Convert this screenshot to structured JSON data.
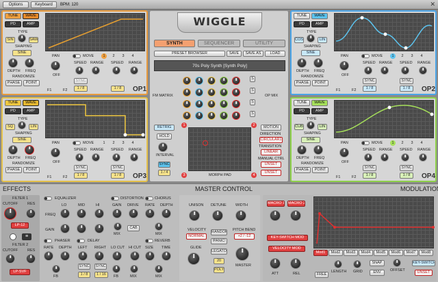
{
  "topbar": {
    "options": "Options",
    "keyboard": "Keyboard",
    "bpm": "BPM: 120",
    "close": "✕"
  },
  "logo": "WIGGLE",
  "tabs": [
    "SYNTH",
    "SEQUENCER",
    "UTILITY"
  ],
  "preset": {
    "browser": "PRESET BROWSER",
    "save": "SAVE",
    "save_as": "SAVE AS",
    "load": "LOAD",
    "name": "70s Poly Synth [Synth Poly]"
  },
  "center": {
    "fm_matrix": "FM MATRIX",
    "op_mix": "OP MIX",
    "s": "S",
    "retrig": "RETRIG",
    "hold": "HOLD",
    "interval": "INTERVAL",
    "sync": "SYNC",
    "quarter": "1 / 4",
    "motion": "MOTION",
    "direction": "DIRECTION",
    "circular": "CIRCULAR1",
    "transition": "TRANSITION",
    "linear": "LINEAR",
    "manual_ctrl": "MANUAL CTRL",
    "unset": "UNSET",
    "morph_pad": "MORPH PAD",
    "n1": "1",
    "n2": "2",
    "n3": "3",
    "n4": "4"
  },
  "op": {
    "tune": "TUNE",
    "wave": "WAVE",
    "pd": "PD",
    "amp": "AMP",
    "type": "TYPE",
    "shaping": "SHAPING",
    "sine": "SINE",
    "depth": "DEPTH",
    "freq": "FREQ",
    "randomize": "RANDOMIZE",
    "phase": "PHASE",
    "point": "POINT",
    "pan": "PAN",
    "move": "MOVE",
    "off": "OFF",
    "speed": "SPEED",
    "range": "RANGE",
    "sync": "SYNC",
    "eighth": "1 / 8",
    "f1": "F1",
    "f2": "F2",
    "n1": "1",
    "n2": "2",
    "n3": "3",
    "n4": "4"
  },
  "op1": {
    "label": "OP1",
    "type_a": "SIN",
    "type_b": "SAW"
  },
  "op2": {
    "label": "OP2",
    "type_a": "COS",
    "type_b": "LIN"
  },
  "op3": {
    "label": "OP3",
    "type_a": "SQ",
    "type_b": "LIN"
  },
  "op4": {
    "label": "OP4",
    "type_a": "CUB",
    "type_b": "LIN"
  },
  "effects": {
    "title": "EFFECTS",
    "filter1": "FILTER 1",
    "cutoff": "CUTOFF",
    "res": "RES",
    "lp12": "LP-12",
    "filter2": "FILTER 2",
    "lpsvf": "LP-SVF",
    "equalizer": "EQUALIZER",
    "freq": "FREQ",
    "lo": "LO",
    "mid": "MID",
    "hi": "HI",
    "gain": "GAIN",
    "distortion": "DISTORTION",
    "drive": "DRIVE",
    "mix": "MIX",
    "cab": "CAB",
    "chorus": "CHORUS",
    "rate": "RATE",
    "depth": "DEPTH",
    "phaser": "PHASER",
    "fb": "FB",
    "delay": "DELAY",
    "left": "LEFT",
    "right": "RIGHT",
    "locut": "LO CUT",
    "hicut": "HI CUT",
    "sync": "SYNC",
    "eighth": "1 / 8",
    "sixteenth": "1 / 16",
    "reverb": "REVERB",
    "size": "SIZE",
    "time": "TIME"
  },
  "master": {
    "title": "MASTER CONTROL",
    "unison": "UNISON",
    "detune": "DETUNE",
    "width": "WIDTH",
    "velocity": "VELOCITY",
    "normal": "NORMAL",
    "random": "RANDOM",
    "panic": "!PANIC!",
    "pitch_bend": "PITCH BEND",
    "pb_val": "+2 / -12",
    "glide": "GLIDE",
    "legato": "LEGATO",
    "voices": "20",
    "poly": "POLY",
    "master": "MASTER"
  },
  "mod": {
    "title": "MODULATIONS",
    "macro1": "MACRO 1",
    "macro2": "MACRO 2",
    "keyswitch_mod": "KEY-SWITCH MOD",
    "velocity_mod": "VELOCITY MOD",
    "att": "ATT",
    "rel": "REL",
    "tabs": [
      "Mod1",
      "Mod2",
      "Mod3",
      "Mod4",
      "Mod5",
      "Mod6",
      "Mod7",
      "Mod8"
    ],
    "length": "LENGTH",
    "grid": "GRID",
    "snap": "SNAP",
    "offset": "OFFSET",
    "keyswitch": "KEY-SWITCH",
    "free": "FREE",
    "env": "ENV",
    "unset": "UNSET"
  },
  "colors": {
    "op1": "#e89a3c",
    "op2": "#4aa4e8",
    "op3": "#e6c24a",
    "op4": "#8fd24a",
    "red": "#e03030"
  }
}
